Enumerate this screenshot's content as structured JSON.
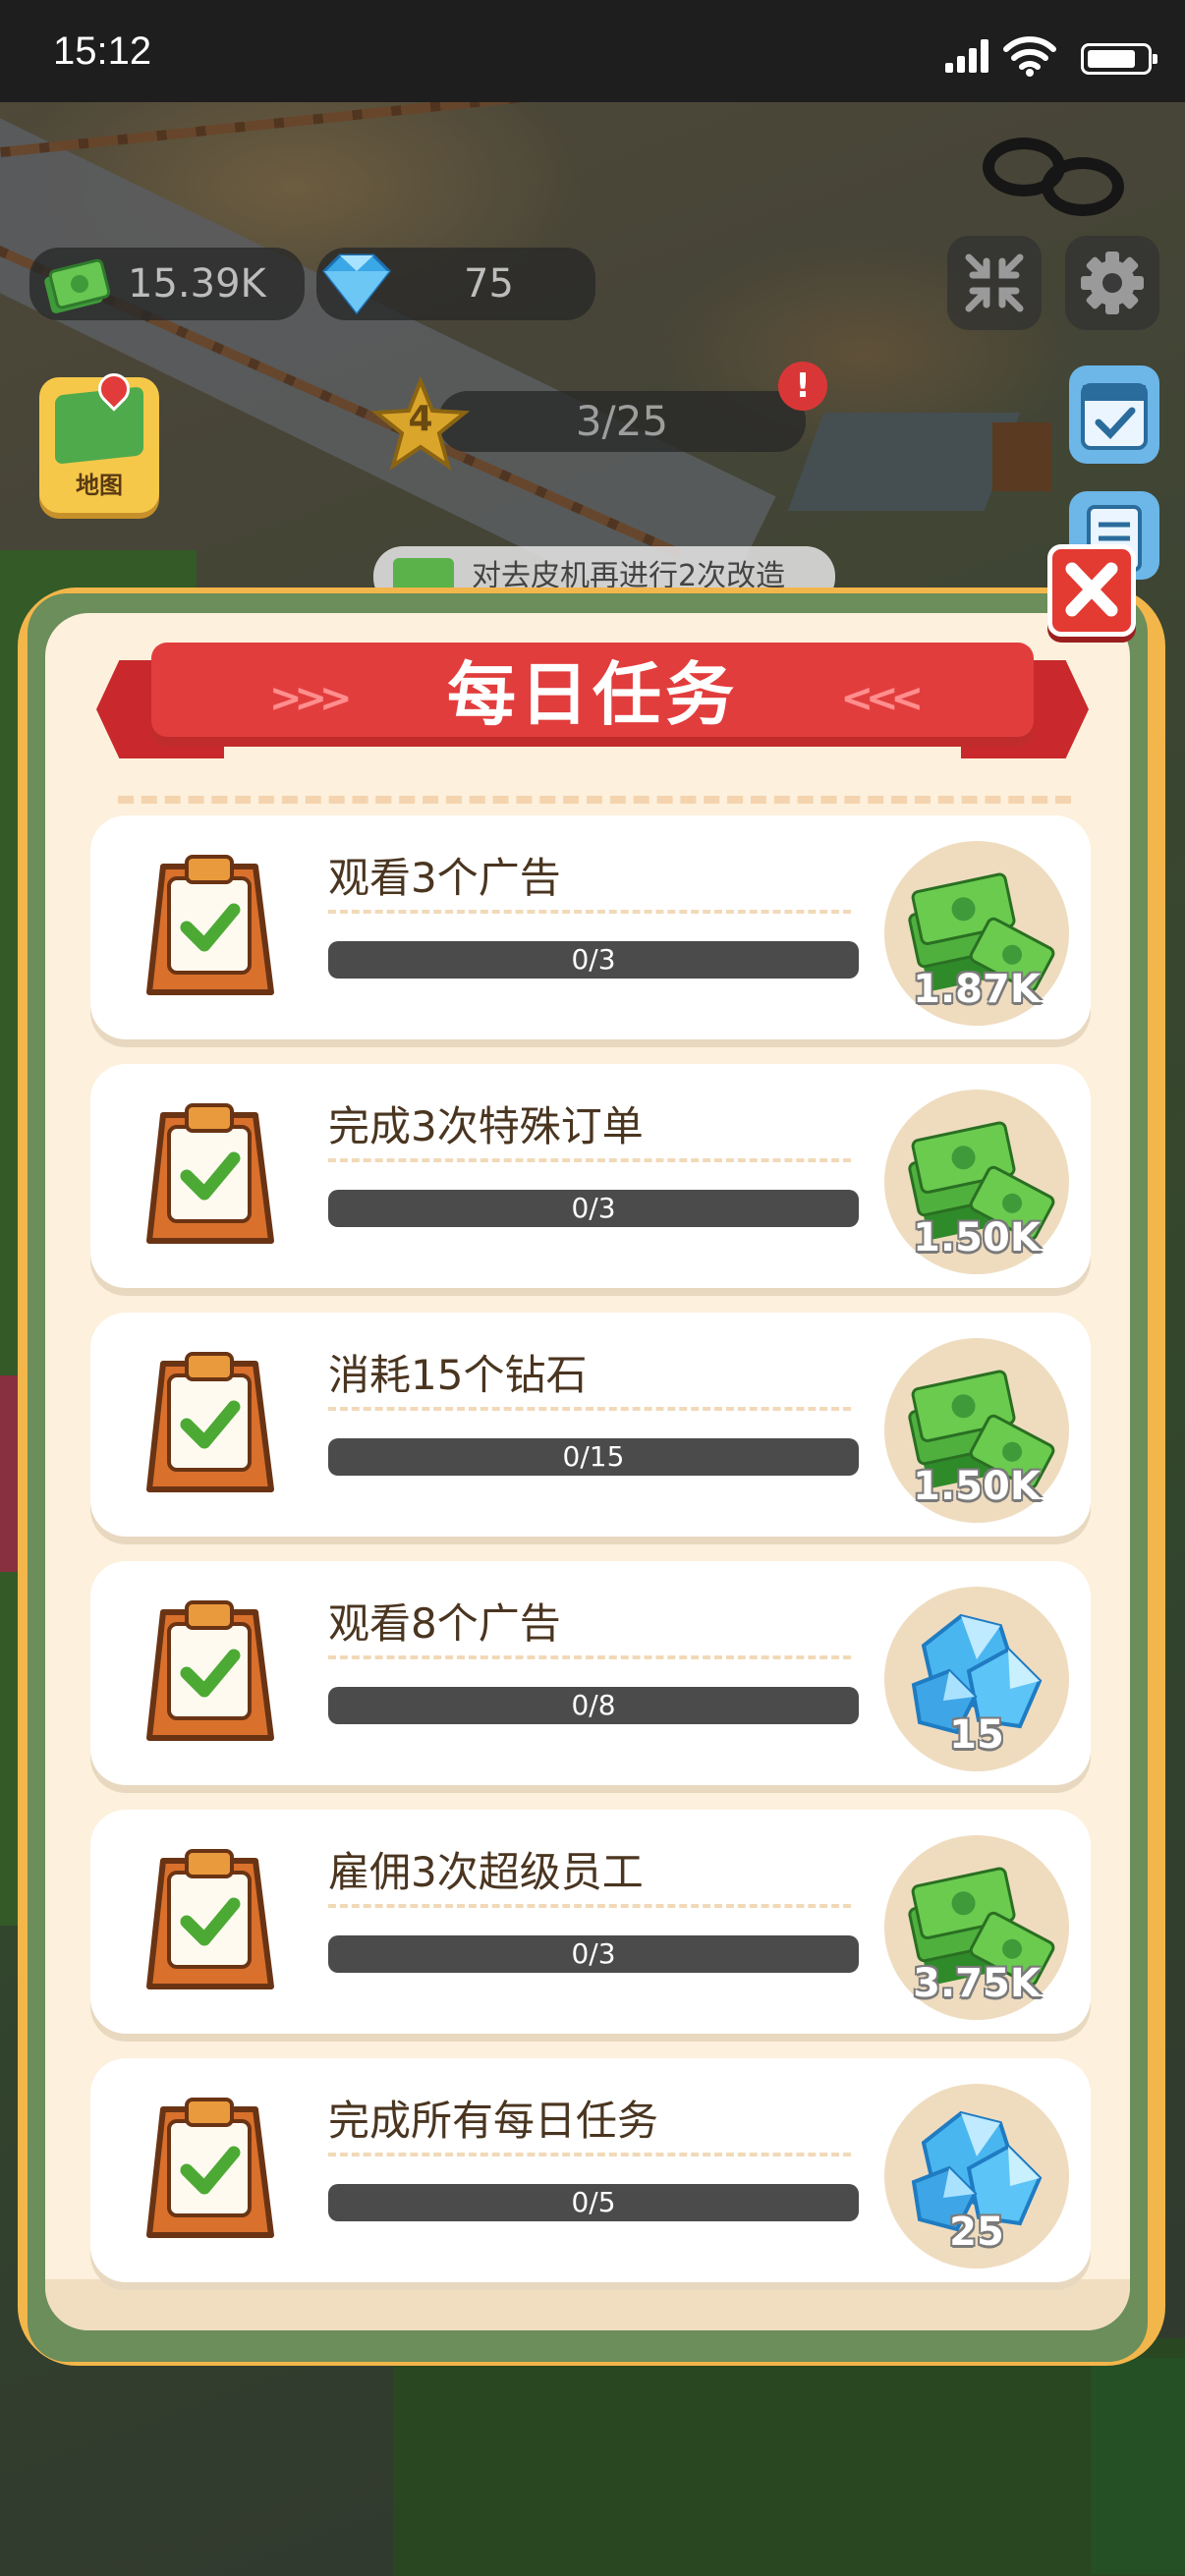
{
  "status_bar": {
    "time": "15:12"
  },
  "hud": {
    "cash": "15.39K",
    "gems": "75",
    "level": "4",
    "level_progress": "3/25",
    "alert_mark": "!",
    "map_label": "地图",
    "quest_hint": "对去皮机再进行2次改造"
  },
  "dialog": {
    "title": "每日任务",
    "left_chevrons": ">>>",
    "right_chevrons": "<<<",
    "tasks": [
      {
        "title": "观看3个广告",
        "progress": "0/3",
        "fraction": 0,
        "reward_type": "cash",
        "reward": "1.87K"
      },
      {
        "title": "完成3次特殊订单",
        "progress": "0/3",
        "fraction": 0,
        "reward_type": "cash",
        "reward": "1.50K"
      },
      {
        "title": "消耗15个钻石",
        "progress": "0/15",
        "fraction": 0,
        "reward_type": "cash",
        "reward": "1.50K"
      },
      {
        "title": "观看8个广告",
        "progress": "0/8",
        "fraction": 0,
        "reward_type": "gem",
        "reward": "15"
      },
      {
        "title": "雇佣3次超级员工",
        "progress": "0/3",
        "fraction": 0,
        "reward_type": "cash",
        "reward": "3.75K"
      },
      {
        "title": "完成所有每日任务",
        "progress": "0/5",
        "fraction": 0,
        "reward_type": "gem",
        "reward": "25"
      }
    ]
  },
  "colors": {
    "accent_red": "#e23d3d",
    "frame_orange": "#f3b64a",
    "frame_green": "#6b8e5a",
    "panel_cream": "#fdf0dc"
  },
  "icons": {
    "clipboard": "clipboard-check-icon",
    "cash": "cash-stack-icon",
    "gem": "diamond-icon",
    "close": "close-icon",
    "settings": "gear-icon",
    "shrink": "collapse-icon"
  }
}
